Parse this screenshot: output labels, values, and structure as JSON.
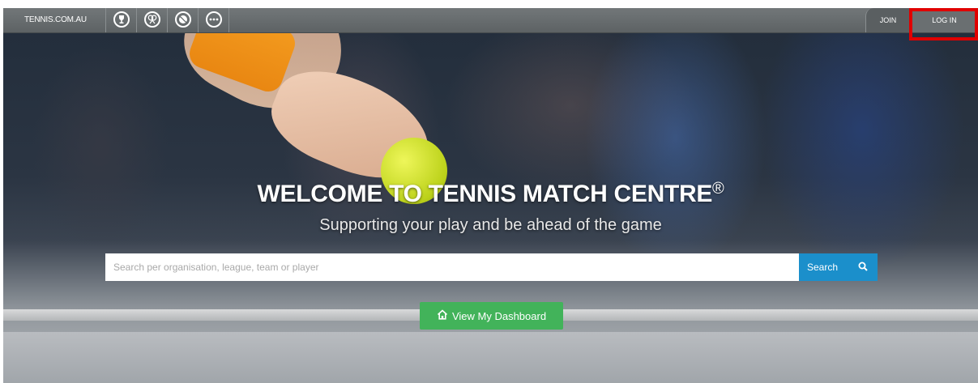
{
  "topbar": {
    "brand": "TENNIS.COM.AU",
    "icons": [
      "trophy-icon",
      "rackets-icon",
      "ball-icon",
      "more-icon"
    ],
    "join_label": "JOIN",
    "login_label": "LOG IN"
  },
  "hero": {
    "title": "WELCOME TO TENNIS MATCH CENTRE",
    "title_mark": "®",
    "subtitle": "Supporting your play and be ahead of the game"
  },
  "search": {
    "placeholder": "Search per organisation, league, team or player",
    "button_label": "Search"
  },
  "dashboard": {
    "label": "View My Dashboard"
  },
  "colors": {
    "search_button": "#1b8fcb",
    "dashboard_button": "#42b35a",
    "highlight": "#e00000"
  }
}
